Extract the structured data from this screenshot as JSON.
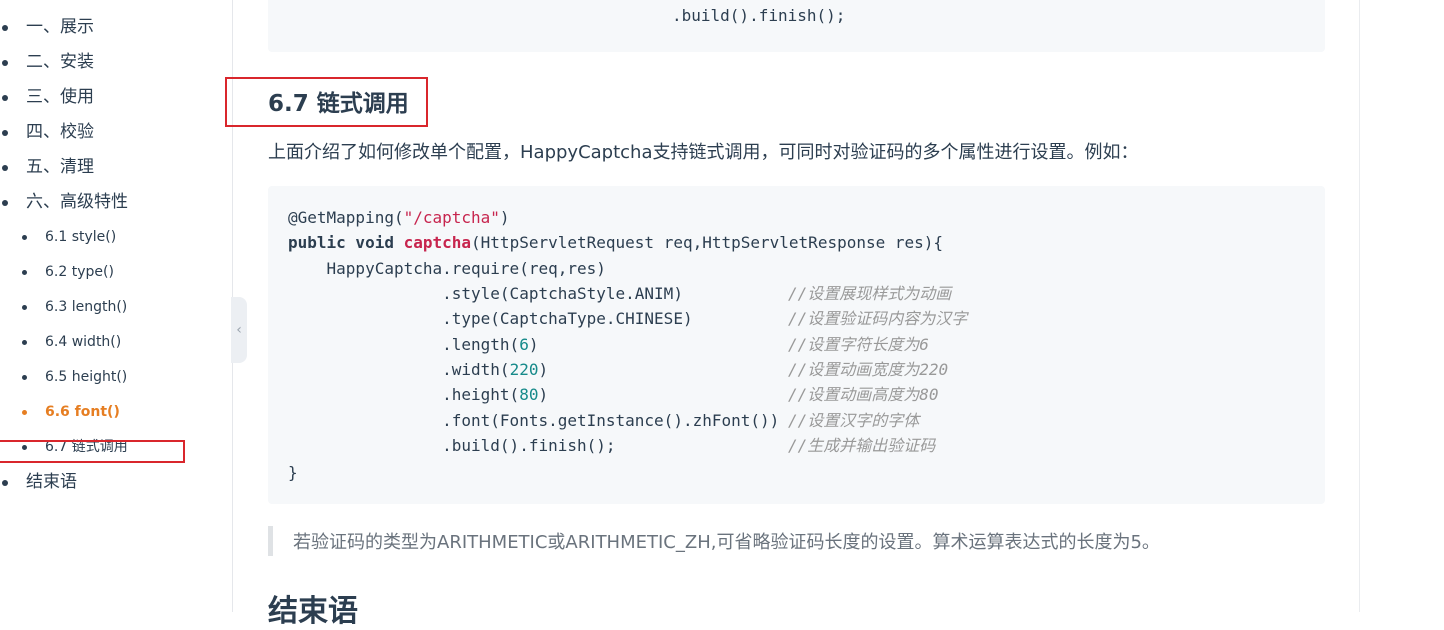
{
  "sidebar": {
    "items": [
      {
        "label": "一、展示",
        "level": 1,
        "active": false
      },
      {
        "label": "二、安装",
        "level": 1,
        "active": false
      },
      {
        "label": "三、使用",
        "level": 1,
        "active": false
      },
      {
        "label": "四、校验",
        "level": 1,
        "active": false
      },
      {
        "label": "五、清理",
        "level": 1,
        "active": false
      },
      {
        "label": "六、高级特性",
        "level": 1,
        "active": false
      },
      {
        "label": "6.1 style()",
        "level": 2,
        "active": false
      },
      {
        "label": "6.2 type()",
        "level": 2,
        "active": false
      },
      {
        "label": "6.3 length()",
        "level": 2,
        "active": false
      },
      {
        "label": "6.4 width()",
        "level": 2,
        "active": false
      },
      {
        "label": "6.5 height()",
        "level": 2,
        "active": false
      },
      {
        "label": "6.6 font()",
        "level": 2,
        "active": true
      },
      {
        "label": "6.7 链式调用",
        "level": 2,
        "active": false
      },
      {
        "label": "结束语",
        "level": 1,
        "active": false
      }
    ],
    "collapse_icon": "‹"
  },
  "code_top": {
    "cut_line": "(...)",
    "last_line": ".build().finish();"
  },
  "section": {
    "title": "6.7 链式调用",
    "intro": "上面介绍了如何修改单个配置，HappyCaptcha支持链式调用，可同时对验证码的多个属性进行设置。例如："
  },
  "code_main": {
    "line1": {
      "anno": "@GetMapping(",
      "str": "\"/captcha\"",
      "end": ")"
    },
    "line2": {
      "kw": "public void ",
      "fn": "captcha",
      "rest": "(HttpServletRequest req,HttpServletResponse res){"
    },
    "line3": "    HappyCaptcha.require(req,res)",
    "line4": {
      "code": "                .style(CaptchaStyle.ANIM)",
      "comment": "//设置展现样式为动画"
    },
    "line5": {
      "code": "                .type(CaptchaType.CHINESE)",
      "comment": "//设置验证码内容为汉字"
    },
    "line6": {
      "pre": "                .length(",
      "num": "6",
      "post": ")",
      "comment": "//设置字符长度为6"
    },
    "line7": {
      "pre": "                .width(",
      "num": "220",
      "post": ")",
      "comment": "//设置动画宽度为220"
    },
    "line8": {
      "pre": "                .height(",
      "num": "80",
      "post": ")",
      "comment": "//设置动画高度为80"
    },
    "line9": {
      "code": "                .font(Fonts.getInstance().zhFont())",
      "comment": "//设置汉字的字体"
    },
    "line10": {
      "code": "                .build().finish();",
      "comment": "//生成并输出验证码"
    },
    "line11": "}"
  },
  "tip": "若验证码的类型为ARITHMETIC或ARITHMETIC_ZH,可省略验证码长度的设置。算术运算表达式的长度为5。",
  "conclusion_heading": "结束语",
  "colors": {
    "accent": "#e67e22",
    "highlight_box": "#d9262c",
    "code_bg": "#f6f8fa",
    "comment": "#999999",
    "string": "#c7254e",
    "number": "#168a8a"
  }
}
